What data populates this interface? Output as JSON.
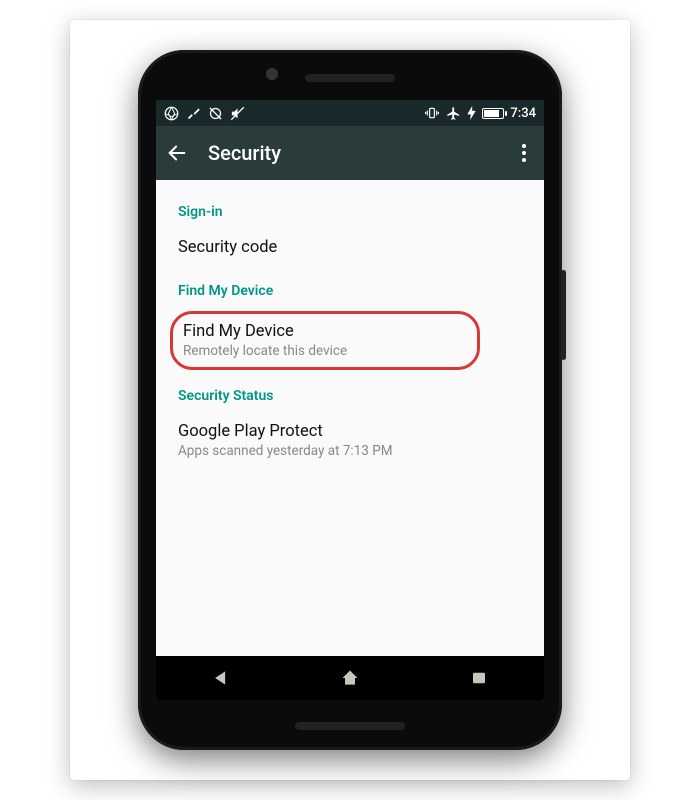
{
  "status": {
    "time": "7:34"
  },
  "appbar": {
    "title": "Security"
  },
  "sections": {
    "signin": {
      "header": "Sign-in",
      "item_title": "Security code"
    },
    "find": {
      "header": "Find My Device",
      "item_title": "Find My Device",
      "item_sub": "Remotely locate this device"
    },
    "status": {
      "header": "Security Status",
      "item_title": "Google Play Protect",
      "item_sub": "Apps scanned yesterday at 7:13 PM"
    }
  }
}
